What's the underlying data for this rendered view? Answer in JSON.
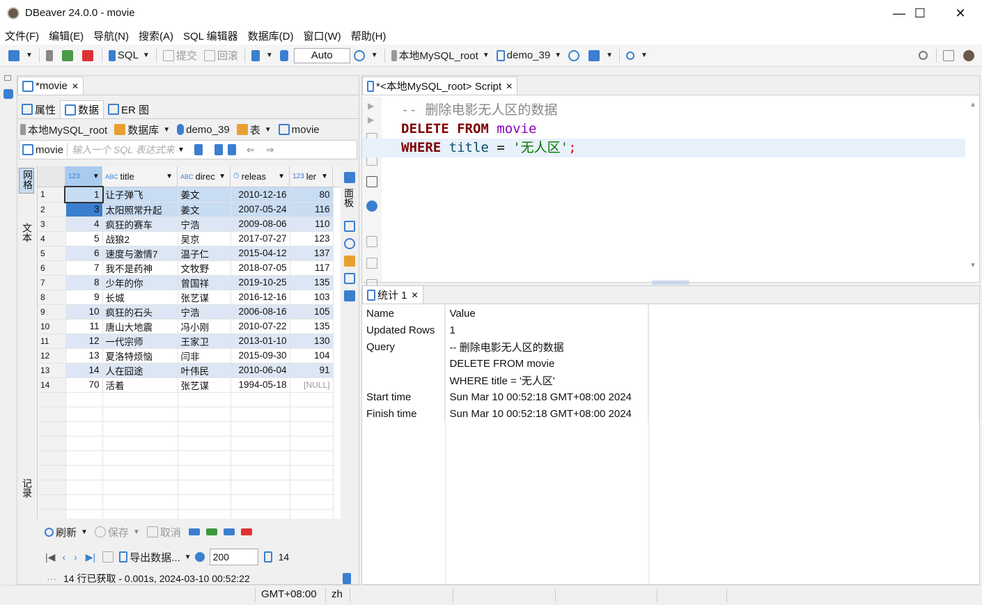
{
  "window": {
    "title": "DBeaver 24.0.0 - movie",
    "min": "—",
    "max": "☐",
    "close": "✕"
  },
  "menu": [
    "文件(F)",
    "编辑(E)",
    "导航(N)",
    "搜索(A)",
    "SQL 编辑器",
    "数据库(D)",
    "窗口(W)",
    "帮助(H)"
  ],
  "toolbar": {
    "sql": "SQL",
    "commit": "提交",
    "rollback": "回滚",
    "auto": "Auto",
    "connection": "本地MySQL_root",
    "schema": "demo_39"
  },
  "left": {
    "tab_title": "*movie",
    "subtabs": [
      "属性",
      "数据",
      "ER 图"
    ],
    "breadcrumb": {
      "conn": "本地MySQL_root",
      "db": "数据库",
      "schema": "demo_39",
      "tables": "表",
      "table": "movie"
    },
    "filter": {
      "table": "movie",
      "placeholder": "输入一个 SQL 表达式来过滤结果 (使用 Ctrl+Space)"
    },
    "side_labels": {
      "grid": "网格",
      "text": "文本",
      "record": "记录",
      "panel": "面板"
    },
    "columns": [
      {
        "type": "123",
        "name": ""
      },
      {
        "type": "ABC",
        "name": "title"
      },
      {
        "type": "ABC",
        "name": "direc"
      },
      {
        "type": "⏱",
        "name": "releas"
      },
      {
        "type": "123",
        "name": "ler"
      }
    ],
    "rows": [
      {
        "n": "1",
        "id": "1",
        "title": "让子弹飞",
        "dir": "姜文",
        "date": "2010-12-16",
        "len": "80"
      },
      {
        "n": "2",
        "id": "3",
        "title": "太阳照常升起",
        "dir": "姜文",
        "date": "2007-05-24",
        "len": "116"
      },
      {
        "n": "3",
        "id": "4",
        "title": "疯狂的赛车",
        "dir": "宁浩",
        "date": "2009-08-06",
        "len": "110"
      },
      {
        "n": "4",
        "id": "5",
        "title": "战狼2",
        "dir": "吴京",
        "date": "2017-07-27",
        "len": "123"
      },
      {
        "n": "5",
        "id": "6",
        "title": "速度与激情7",
        "dir": "温子仁",
        "date": "2015-04-12",
        "len": "137"
      },
      {
        "n": "6",
        "id": "7",
        "title": "我不是药神",
        "dir": "文牧野",
        "date": "2018-07-05",
        "len": "117"
      },
      {
        "n": "7",
        "id": "8",
        "title": "少年的你",
        "dir": "曾国祥",
        "date": "2019-10-25",
        "len": "135"
      },
      {
        "n": "8",
        "id": "9",
        "title": "长城",
        "dir": "张艺谋",
        "date": "2016-12-16",
        "len": "103"
      },
      {
        "n": "9",
        "id": "10",
        "title": "疯狂的石头",
        "dir": "宁浩",
        "date": "2006-08-16",
        "len": "105"
      },
      {
        "n": "10",
        "id": "11",
        "title": "唐山大地震",
        "dir": "冯小刚",
        "date": "2010-07-22",
        "len": "135"
      },
      {
        "n": "11",
        "id": "12",
        "title": "一代宗师",
        "dir": "王家卫",
        "date": "2013-01-10",
        "len": "130"
      },
      {
        "n": "12",
        "id": "13",
        "title": "夏洛特烦恼",
        "dir": "闫非",
        "date": "2015-09-30",
        "len": "104"
      },
      {
        "n": "13",
        "id": "14",
        "title": "人在囧途",
        "dir": "叶伟民",
        "date": "2010-06-04",
        "len": "91"
      },
      {
        "n": "14",
        "id": "70",
        "title": "活着",
        "dir": "张艺谋",
        "date": "1994-05-18",
        "len": "[NULL]"
      }
    ],
    "bottom": {
      "refresh": "刷新",
      "save": "保存",
      "cancel": "取消",
      "export": "导出数据...",
      "fetch_size": "200",
      "count": "14",
      "status": "14 行已获取 - 0.001s, 2024-03-10 00:52:22"
    }
  },
  "editor": {
    "tab_title": "*<本地MySQL_root> Script",
    "lines": {
      "comment": "--  删除电影无人区的数据",
      "kw1": "DELETE FROM",
      "tbl": "movie",
      "kw2": "WHERE",
      "col": "title",
      "eq": "=",
      "val": "'无人区'",
      "semi": ";"
    }
  },
  "stats": {
    "tab_title": "统计 1",
    "header": {
      "name": "Name",
      "value": "Value"
    },
    "rows": [
      {
        "name": "Updated Rows",
        "value": "1"
      },
      {
        "name": "Query",
        "value": "-- 删除电影无人区的数据"
      },
      {
        "name": "",
        "value": "DELETE FROM movie"
      },
      {
        "name": "",
        "value": "WHERE title = '无人区'"
      },
      {
        "name": "Start time",
        "value": "Sun Mar 10 00:52:18 GMT+08:00 2024"
      },
      {
        "name": "Finish time",
        "value": "Sun Mar 10 00:52:18 GMT+08:00 2024"
      }
    ]
  },
  "statusbar": {
    "tz": "GMT+08:00",
    "lang": "zh"
  },
  "colors": {
    "selection": "#c8dcf2",
    "alt_row": "#dce6f4",
    "keyword": "#7f0000",
    "string": "#007700"
  }
}
